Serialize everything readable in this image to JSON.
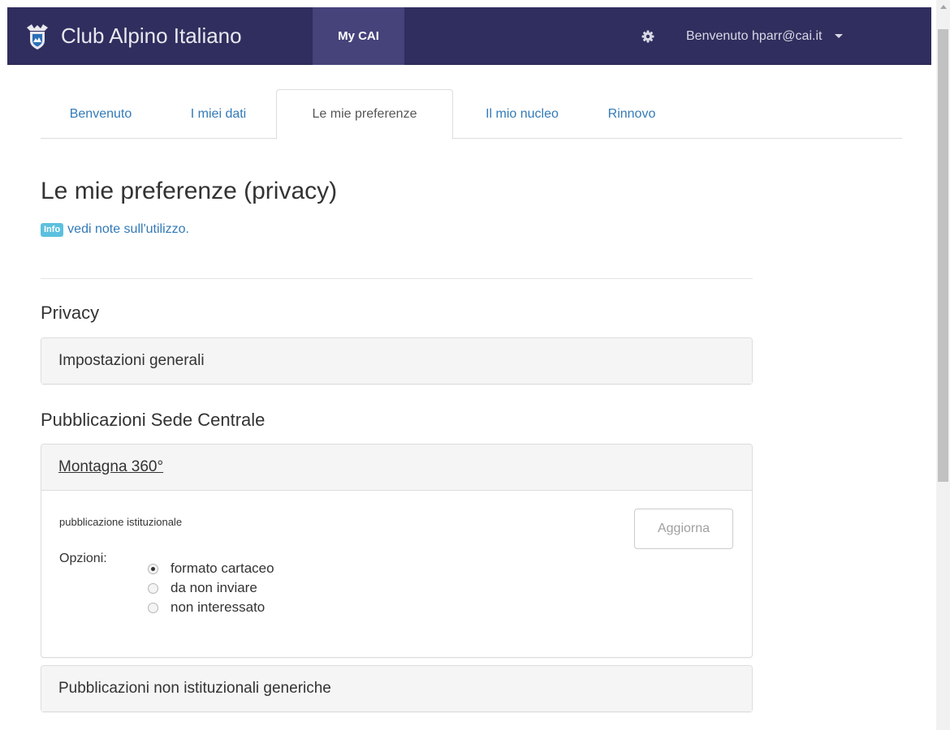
{
  "navbar": {
    "brand": "Club Alpino Italiano",
    "mycai_label": "My CAI",
    "user_label": "Benvenuto hparr@cai.it",
    "bg_color": "#302e5e",
    "active_color": "#45437a"
  },
  "tabs": [
    {
      "label": "Benvenuto",
      "active": false
    },
    {
      "label": "I miei dati",
      "active": false
    },
    {
      "label": "Le mie preferenze",
      "active": true
    },
    {
      "label": "Il mio nucleo",
      "active": false
    },
    {
      "label": "Rinnovo",
      "active": false
    }
  ],
  "page": {
    "title": "Le mie preferenze (privacy)",
    "info_badge": "Info",
    "info_link": "vedi note sull'utilizzo."
  },
  "privacy": {
    "section_title": "Privacy",
    "general_panel": "Impostazioni generali"
  },
  "publications": {
    "section_title": "Pubblicazioni Sede Centrale",
    "montagna": {
      "title": "Montagna 360°",
      "description": "pubblicazione istituzionale",
      "update_button": "Aggiorna",
      "options_label": "Opzioni:",
      "options": [
        {
          "label": "formato cartaceo",
          "checked": true
        },
        {
          "label": "da non inviare",
          "checked": false
        },
        {
          "label": "non interessato",
          "checked": false
        }
      ]
    },
    "generic_panel": "Pubblicazioni non istituzionali generiche"
  }
}
